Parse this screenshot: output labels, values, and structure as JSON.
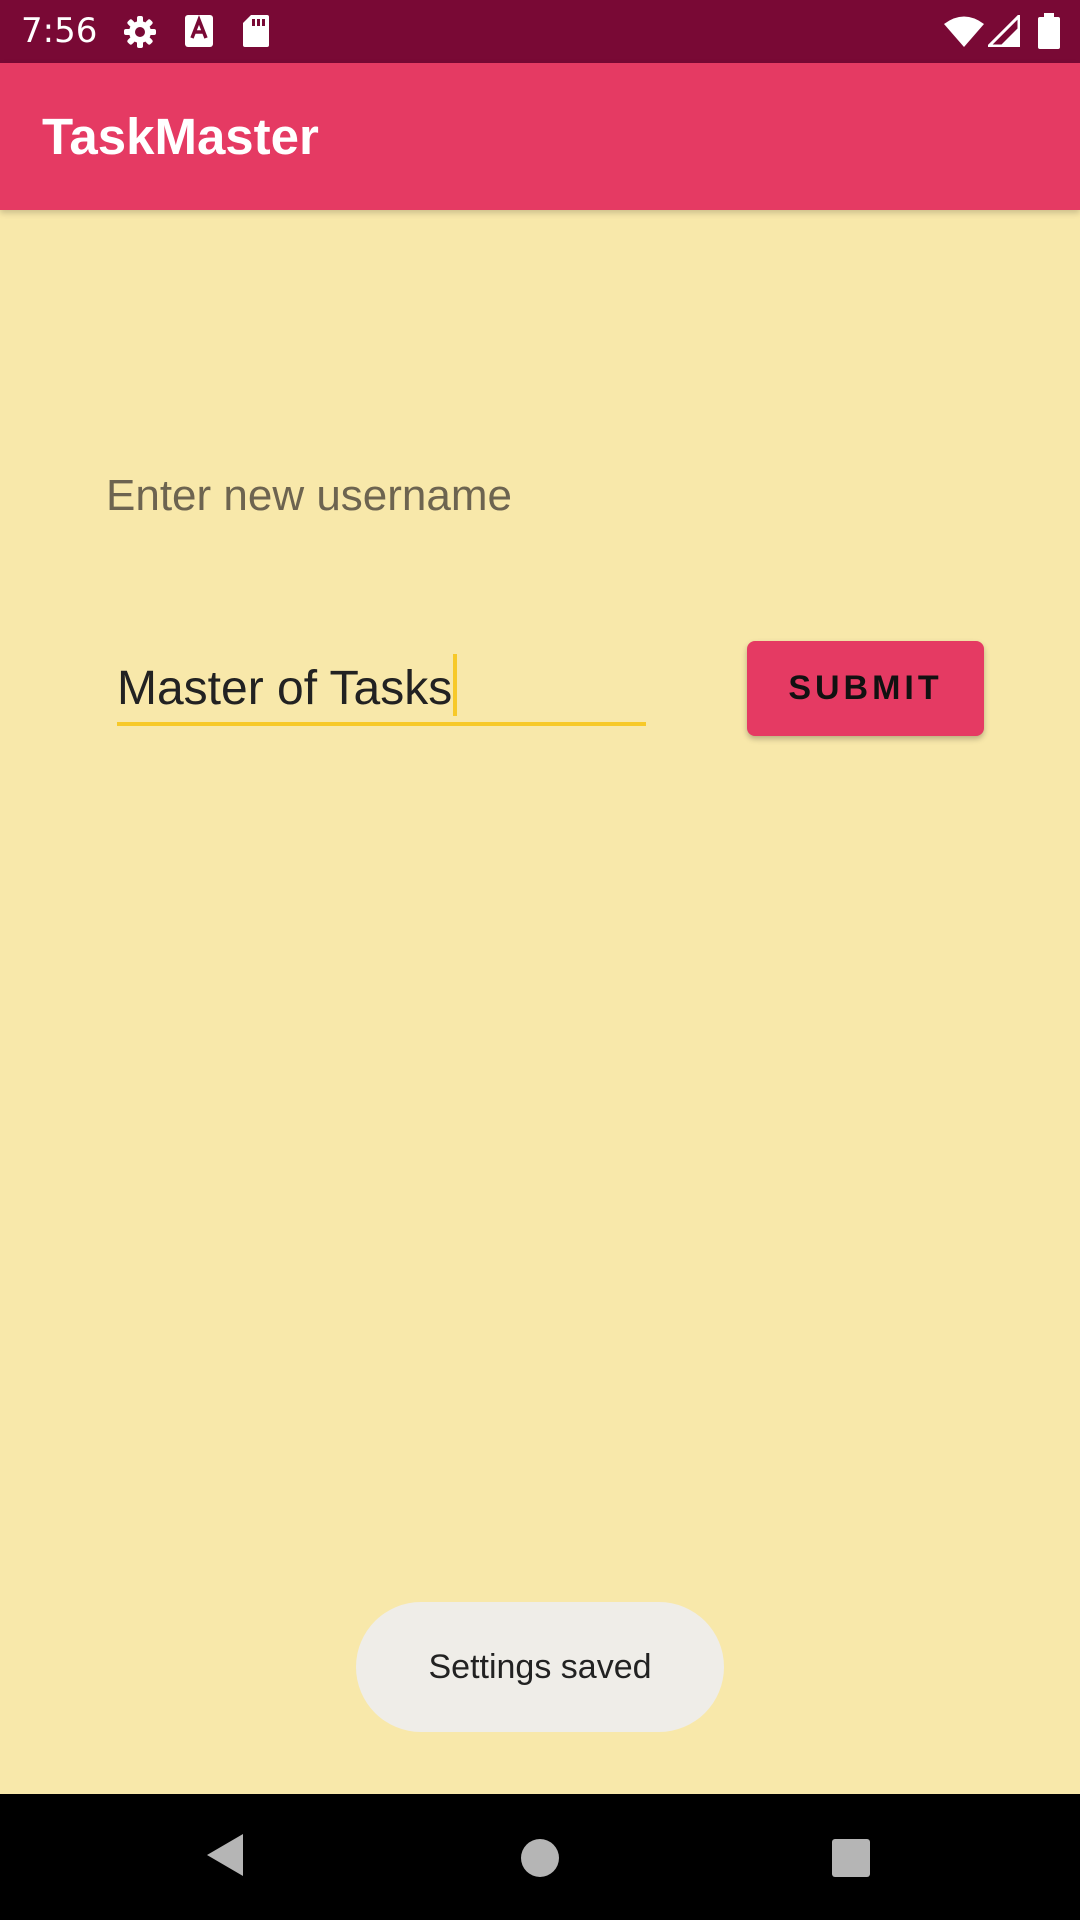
{
  "status_bar": {
    "time": "7:56",
    "icons": [
      "gear-icon",
      "a-notification-icon",
      "sd-card-icon",
      "wifi-icon",
      "signal-icon",
      "battery-icon"
    ],
    "background_color": "#790935"
  },
  "app_bar": {
    "title": "TaskMaster",
    "background_color": "#E53A63"
  },
  "main": {
    "prompt_label": "Enter new username",
    "username_input": {
      "value": "Master of Tasks",
      "focused": true
    },
    "submit_label": "SUBMIT",
    "background_color": "#F8E8AA",
    "accent_color": "#F7C929"
  },
  "toast": {
    "message": "Settings saved"
  },
  "nav_bar": {
    "icons": [
      "back-icon",
      "home-icon",
      "recents-icon"
    ]
  }
}
